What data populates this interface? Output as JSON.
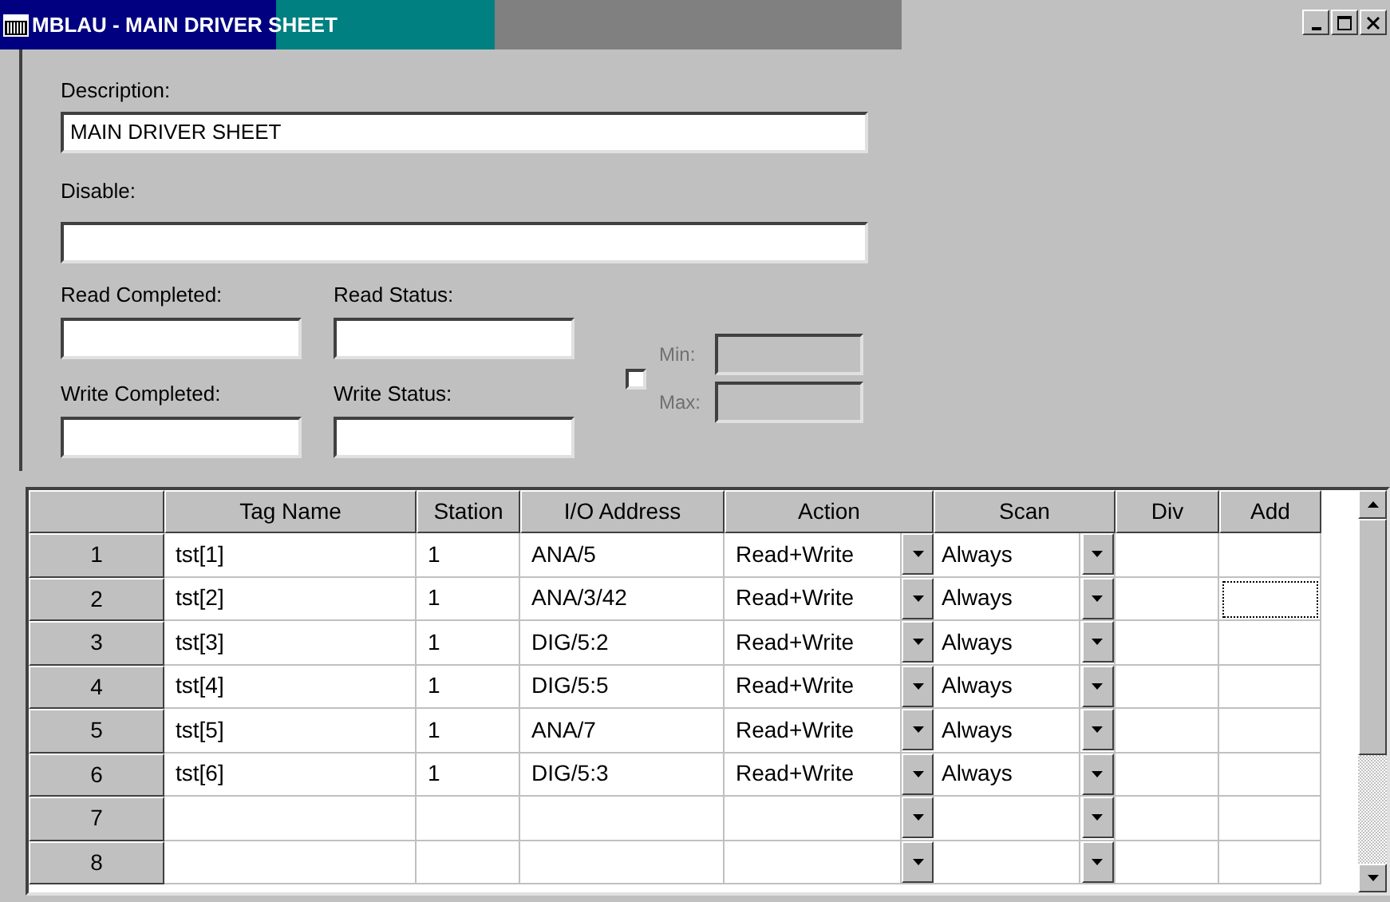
{
  "window": {
    "title": "MBLAU - MAIN DRIVER SHEET"
  },
  "form": {
    "description": {
      "label": "Description:",
      "value": "MAIN DRIVER SHEET"
    },
    "disable": {
      "label": "Disable:"
    },
    "read_completed": {
      "label": "Read Completed:"
    },
    "read_status": {
      "label": "Read Status:"
    },
    "write_completed": {
      "label": "Write Completed:"
    },
    "write_status": {
      "label": "Write Status:"
    },
    "range": {
      "checked": false,
      "disabled": true,
      "min_label": "Min:",
      "max_label": "Max:"
    }
  },
  "table": {
    "columns": [
      "Tag Name",
      "Station",
      "I/O Address",
      "Action",
      "Scan",
      "Div",
      "Add"
    ],
    "rows": [
      {
        "number": "1",
        "tag_name": "tst[1]",
        "station": "1",
        "io_address": "ANA/5",
        "action": "Read+Write",
        "scan": "Always",
        "add_focused": false
      },
      {
        "number": "2",
        "tag_name": "tst[2]",
        "station": "1",
        "io_address": "ANA/3/42",
        "action": "Read+Write",
        "scan": "Always",
        "add_focused": true
      },
      {
        "number": "3",
        "tag_name": "tst[3]",
        "station": "1",
        "io_address": "DIG/5:2",
        "action": "Read+Write",
        "scan": "Always",
        "add_focused": false
      },
      {
        "number": "4",
        "tag_name": "tst[4]",
        "station": "1",
        "io_address": "DIG/5:5",
        "action": "Read+Write",
        "scan": "Always",
        "add_focused": false
      },
      {
        "number": "5",
        "tag_name": "tst[5]",
        "station": "1",
        "io_address": "ANA/7",
        "action": "Read+Write",
        "scan": "Always",
        "add_focused": false
      },
      {
        "number": "6",
        "tag_name": "tst[6]",
        "station": "1",
        "io_address": "DIG/5:3",
        "action": "Read+Write",
        "scan": "Always",
        "add_focused": false
      },
      {
        "number": "7",
        "add_focused": false
      },
      {
        "number": "8",
        "add_focused": false
      }
    ]
  }
}
